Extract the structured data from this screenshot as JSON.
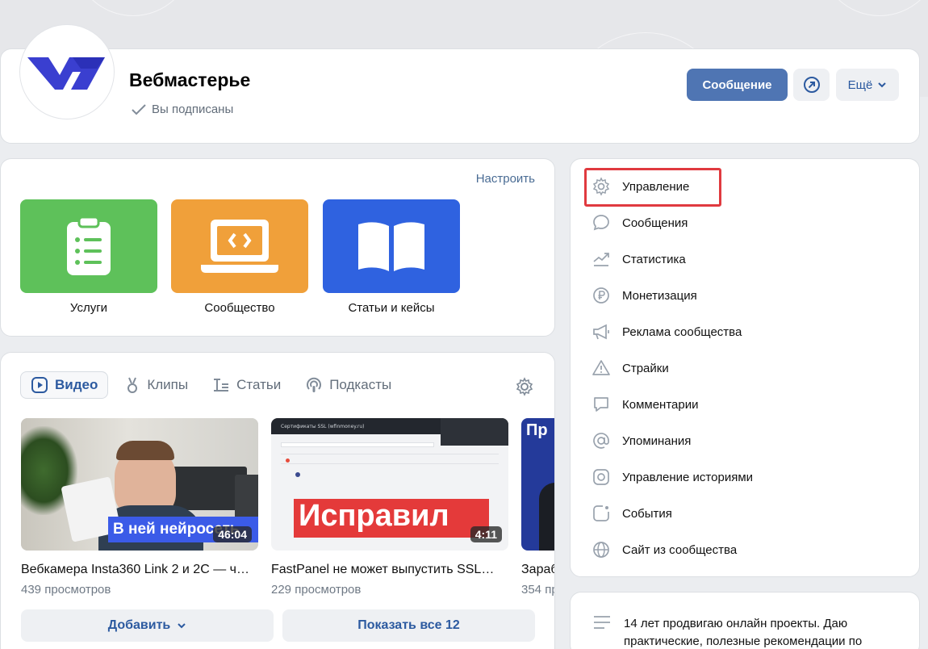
{
  "community": {
    "name": "Вебмастерье",
    "status": "Вы подписаны",
    "message_button": "Сообщение",
    "more_button": "Ещё",
    "brand_color": "#3a3fd0"
  },
  "links_block": {
    "configure": "Настроить",
    "tiles": [
      {
        "label": "Услуги",
        "color": "#5ec15a",
        "icon": "clipboard-list-icon"
      },
      {
        "label": "Сообщество",
        "color": "#f0a03a",
        "icon": "laptop-code-icon"
      },
      {
        "label": "Статьи и кейсы",
        "color": "#2f62e0",
        "icon": "open-book-icon"
      }
    ]
  },
  "media": {
    "tabs": [
      {
        "label": "Видео",
        "icon": "video-icon",
        "active": true
      },
      {
        "label": "Клипы",
        "icon": "clips-icon",
        "active": false
      },
      {
        "label": "Статьи",
        "icon": "articles-icon",
        "active": false
      },
      {
        "label": "Подкасты",
        "icon": "podcasts-icon",
        "active": false
      }
    ],
    "videos": [
      {
        "title": "Вебкамера Insta360 Link 2 и 2C — ч…",
        "views": "439 просмотров",
        "duration": "46:04",
        "overlay": "В ней нейросеть"
      },
      {
        "title": "FastPanel не может выпустить SSL…",
        "views": "229 просмотров",
        "duration": "4:11",
        "overlay": "Исправил",
        "screen_heading": "Сертификаты SSL (wfinmoney.ru)"
      },
      {
        "title": "Зараб",
        "views": "354 пр",
        "overlay": "Пр"
      }
    ],
    "add_button": "Добавить",
    "show_all_button": "Показать все 12"
  },
  "menu": {
    "items": [
      {
        "label": "Управление",
        "icon": "gear-icon"
      },
      {
        "label": "Сообщения",
        "icon": "chat-bubble-icon"
      },
      {
        "label": "Статистика",
        "icon": "chart-trend-icon"
      },
      {
        "label": "Монетизация",
        "icon": "ruble-coin-icon"
      },
      {
        "label": "Реклама сообщества",
        "icon": "megaphone-icon"
      },
      {
        "label": "Страйки",
        "icon": "warning-triangle-icon"
      },
      {
        "label": "Комментарии",
        "icon": "comment-icon"
      },
      {
        "label": "Упоминания",
        "icon": "at-sign-icon"
      },
      {
        "label": "Управление историями",
        "icon": "stories-icon"
      },
      {
        "label": "События",
        "icon": "event-icon"
      },
      {
        "label": "Сайт из сообщества",
        "icon": "globe-icon"
      }
    ],
    "highlight_color": "#e03a3f"
  },
  "about": {
    "text": "14 лет продвигаю онлайн проекты. Даю практические, полезные рекомендации по"
  }
}
